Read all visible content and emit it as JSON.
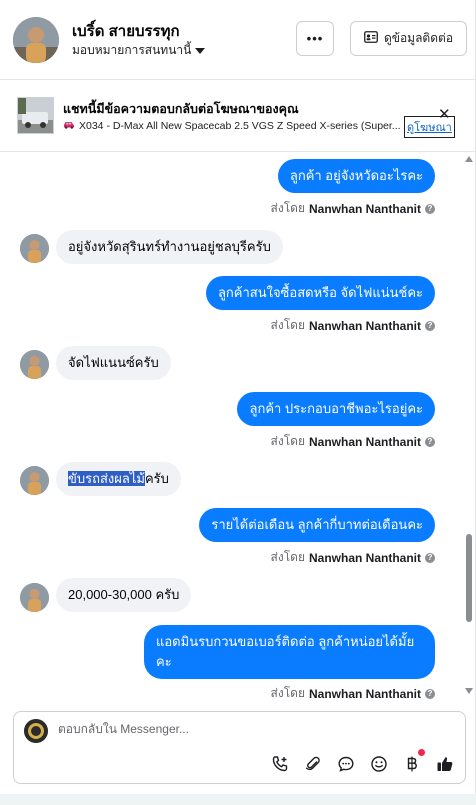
{
  "header": {
    "name": "เบริ์ด สายบรรทุก",
    "assign_label": "มอบหมายการสนทนานี้",
    "more_label": "•••",
    "contact_label": "ดูข้อมูลติดต่อ"
  },
  "ad": {
    "title": "แชทนี้มีข้อความตอบกลับต่อโฆษณาของคุณ",
    "subtitle": "X034 - D-Max All New Spacecab 2.5 VGS Z Speed X-series (Super...",
    "link_label": "ดูโฆษณา",
    "close_label": "✕"
  },
  "messages": {
    "m1": "ลูกค้า อยู่จังหวัดอะไรคะ",
    "m2": "อยู่จังหวัดสุรินทร์ทำงานอยู่ชลบุรีครับ",
    "m3": "ลูกค้าสนใจซื้อสดหรือ จัดไฟแน่นช์คะ",
    "m4": "จัดไฟแนนซ์ครับ",
    "m5": "ลูกค้า ประกอบอาชีพอะไรอยู่คะ",
    "m6_highlight": "ขับรถส่งผลไม้",
    "m6_rest": "ครับ",
    "m7": "รายได้ต่อเดือน  ลูกค้ากี่บาทต่อเดือนคะ",
    "m8": "20,000-30,000 ครับ",
    "m9": "แอดมินรบกวนขอเบอร์ติดต่อ ลูกค้าหน่อยได้มั้ยคะ"
  },
  "sent_by": {
    "prefix": "ส่งโดย",
    "name": "Nanwhan Nanthanit"
  },
  "composer": {
    "placeholder": "ตอบกลับใน Messenger..."
  },
  "icons": {
    "bubble_out_color": "#0a7cff",
    "bubble_in_color": "#f0f2f5",
    "notification_dot_color": "#f02849"
  }
}
